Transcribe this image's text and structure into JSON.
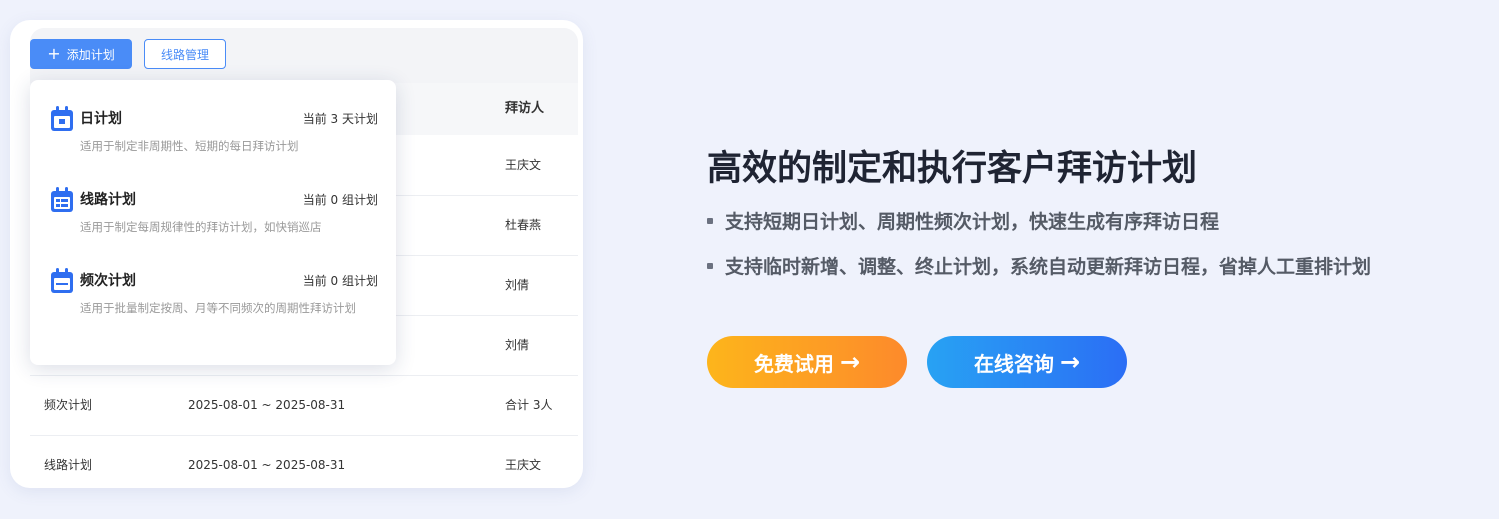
{
  "toolbar": {
    "add_label": "添加计划",
    "add_icon": "plus-icon",
    "route_label": "线路管理"
  },
  "table": {
    "visitor_header": "拜访人",
    "rows": [
      {
        "plan": "",
        "date": "",
        "visitor": "王庆文"
      },
      {
        "plan": "",
        "date": "",
        "visitor": "杜春燕"
      },
      {
        "plan": "",
        "date": "",
        "visitor": "刘倩"
      },
      {
        "plan": "",
        "date": "",
        "visitor": "刘倩"
      },
      {
        "plan": "频次计划",
        "date": "2025-08-01 ~ 2025-08-31",
        "visitor": "合计 3人"
      },
      {
        "plan": "线路计划",
        "date": "2025-08-01 ~ 2025-08-31",
        "visitor": "王庆文"
      }
    ]
  },
  "dropdown": {
    "items": [
      {
        "title": "日计划",
        "count": "当前 3 天计划",
        "desc": "适用于制定非周期性、短期的每日拜访计划",
        "icon": "calendar-day-icon"
      },
      {
        "title": "线路计划",
        "count": "当前 0 组计划",
        "desc": "适用于制定每周规律性的拜访计划，如快销巡店",
        "icon": "calendar-route-icon"
      },
      {
        "title": "频次计划",
        "count": "当前 0 组计划",
        "desc": "适用于批量制定按周、月等不同频次的周期性拜访计划",
        "icon": "calendar-frequency-icon"
      }
    ]
  },
  "hero": {
    "heading": "高效的制定和执行客户拜访计划",
    "bullets": [
      "支持短期日计划、周期性频次计划，快速生成有序拜访日程",
      "支持临时新增、调整、终止计划，系统自动更新拜访日程，省掉人工重排计划"
    ],
    "try_label": "免费试用",
    "consult_label": "在线咨询",
    "arrow": "arrow-right-icon"
  },
  "colors": {
    "accent": "#4a8cf7",
    "try_gradient_start": "#fdb51b",
    "try_gradient_end": "#fd8a2b",
    "consult_gradient_start": "#28a2f3",
    "consult_gradient_end": "#2b6ef5",
    "background": "#eff2fc"
  }
}
